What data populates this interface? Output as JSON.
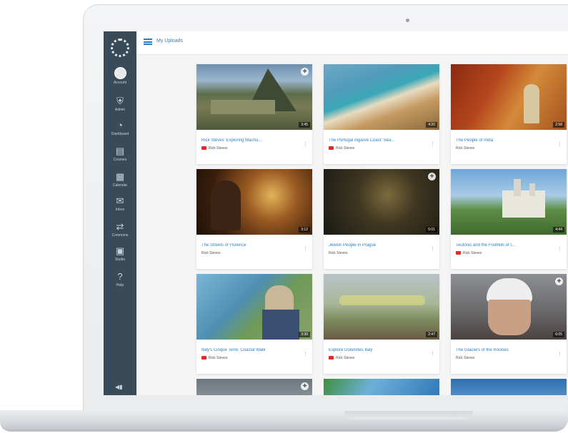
{
  "header": {
    "breadcrumb": "My Uploads"
  },
  "sidebar": {
    "items": [
      {
        "label": "Account",
        "icon": "avatar-icon"
      },
      {
        "label": "Admin",
        "icon": "shield-icon"
      },
      {
        "label": "Dashboard",
        "icon": "dashboard-icon"
      },
      {
        "label": "Courses",
        "icon": "book-icon"
      },
      {
        "label": "Calendar",
        "icon": "calendar-icon"
      },
      {
        "label": "Inbox",
        "icon": "inbox-icon"
      },
      {
        "label": "Commons",
        "icon": "commons-icon"
      },
      {
        "label": "Studio",
        "icon": "studio-icon"
      },
      {
        "label": "Help",
        "icon": "help-icon"
      }
    ]
  },
  "videos": [
    {
      "title": "Rick Steves' Exploring Machu...",
      "channel": "Rick Steves",
      "youtube": true,
      "duration": "3:45"
    },
    {
      "title": "The Portugal Algarve Coast: Sea...",
      "channel": "Rick Steves",
      "youtube": true,
      "duration": "4:20"
    },
    {
      "title": "The People of India",
      "channel": "Rick Steves",
      "youtube": false,
      "duration": "2:58"
    },
    {
      "title": "The Streets of Florence",
      "channel": "Rick Steves",
      "youtube": false,
      "duration": "3:12"
    },
    {
      "title": "Jewish People in Prague",
      "channel": "Rick Steves",
      "youtube": false,
      "duration": "5:01"
    },
    {
      "title": "Teutonic and the Foothills of t...",
      "channel": "Rick Steves",
      "youtube": true,
      "duration": "4:44"
    },
    {
      "title": "Italy's Cinque Terre: Coastal Walk",
      "channel": "Rick Steves",
      "youtube": true,
      "duration": "3:30"
    },
    {
      "title": "Explore Dolomites Italy",
      "channel": "Rick Steves",
      "youtube": true,
      "duration": "2:47"
    },
    {
      "title": "The Glaciers of the Rockies",
      "channel": "Rick Steves",
      "youtube": false,
      "duration": "6:05"
    }
  ],
  "colors": {
    "sidebar": "#394b58",
    "accent": "#2d7fc1",
    "youtube": "#e02b2b"
  }
}
